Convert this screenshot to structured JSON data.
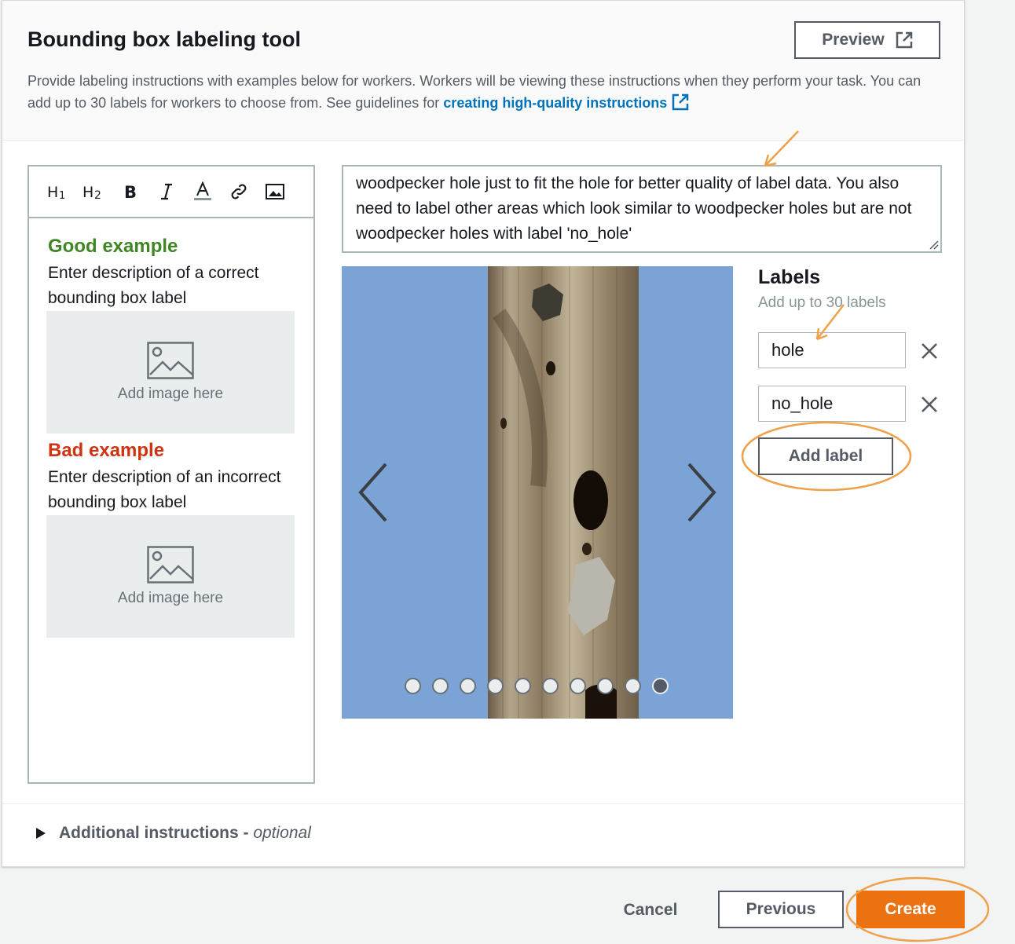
{
  "header": {
    "title": "Bounding box labeling tool",
    "preview_label": "Preview",
    "description": "Provide labeling instructions with examples below for workers. Workers will be viewing these instructions when they perform your task. You can add up to 30 labels for workers to choose from. See guidelines for ",
    "link_text": "creating high-quality instructions"
  },
  "editor": {
    "toolbar": [
      "H1",
      "H2",
      "B",
      "I",
      "A",
      "link",
      "image"
    ],
    "good_title": "Good example",
    "good_desc": "Enter description of a correct bounding box label",
    "bad_title": "Bad example",
    "bad_desc": "Enter description of an incorrect bounding box label",
    "image_placeholder": "Add image here"
  },
  "instructions": {
    "text": "woodpecker hole just to fit the hole for better quality of label data. You also need to label other areas which look similar to woodpecker holes but are not woodpecker holes with label 'no_hole'"
  },
  "carousel": {
    "dot_count": 10,
    "active_dot": 10
  },
  "labels": {
    "title": "Labels",
    "subtitle": "Add up to 30 labels",
    "items": [
      "hole",
      "no_hole"
    ],
    "add_label": "Add label"
  },
  "additional": {
    "label": "Additional instructions - ",
    "optional": "optional"
  },
  "footer": {
    "cancel": "Cancel",
    "previous": "Previous",
    "create": "Create"
  },
  "colors": {
    "accent": "#ec7211",
    "link": "#0073bb",
    "good": "#3f8624",
    "bad": "#d13212",
    "annotation": "#f0a048"
  }
}
